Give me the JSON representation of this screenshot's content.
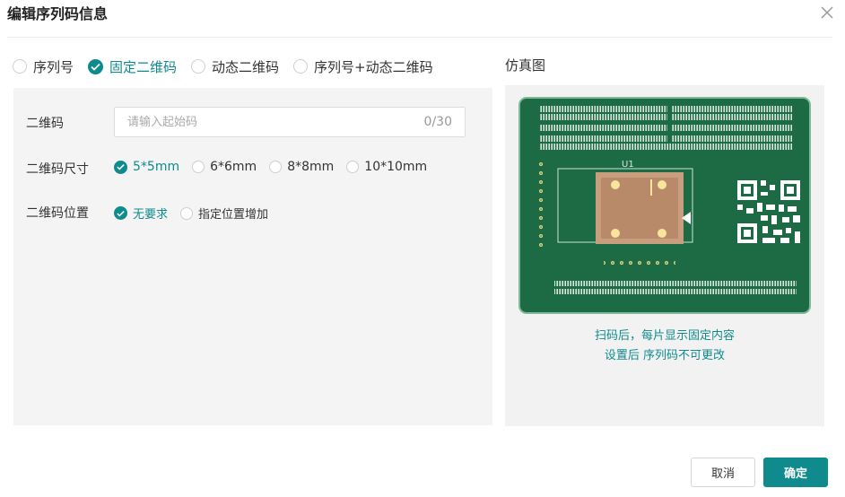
{
  "dialog": {
    "title": "编辑序列码信息",
    "close_icon": "close-icon"
  },
  "modes": [
    {
      "label": "序列号",
      "selected": false
    },
    {
      "label": "固定二维码",
      "selected": true
    },
    {
      "label": "动态二维码",
      "selected": false
    },
    {
      "label": "序列号+动态二维码",
      "selected": false
    }
  ],
  "form": {
    "qr_code": {
      "label": "二维码",
      "value": "",
      "placeholder": "请输入起始码",
      "counter": "0/30"
    },
    "qr_size": {
      "label": "二维码尺寸",
      "options": [
        {
          "label": "5*5mm",
          "selected": true
        },
        {
          "label": "6*6mm",
          "selected": false
        },
        {
          "label": "8*8mm",
          "selected": false
        },
        {
          "label": "10*10mm",
          "selected": false
        }
      ]
    },
    "qr_position": {
      "label": "二维码位置",
      "options": [
        {
          "label": "无要求",
          "selected": true
        },
        {
          "label": "指定位置增加",
          "selected": false
        }
      ]
    }
  },
  "preview": {
    "label": "仿真图",
    "pcb_labels": {
      "designator": "U1"
    },
    "notes": [
      "扫码后，每片显示固定内容",
      "设置后 序列码不可更改"
    ]
  },
  "footer": {
    "cancel_label": "取消",
    "ok_label": "确定"
  },
  "colors": {
    "accent": "#0f8b8d",
    "pcb_green": "#1d6b45"
  }
}
